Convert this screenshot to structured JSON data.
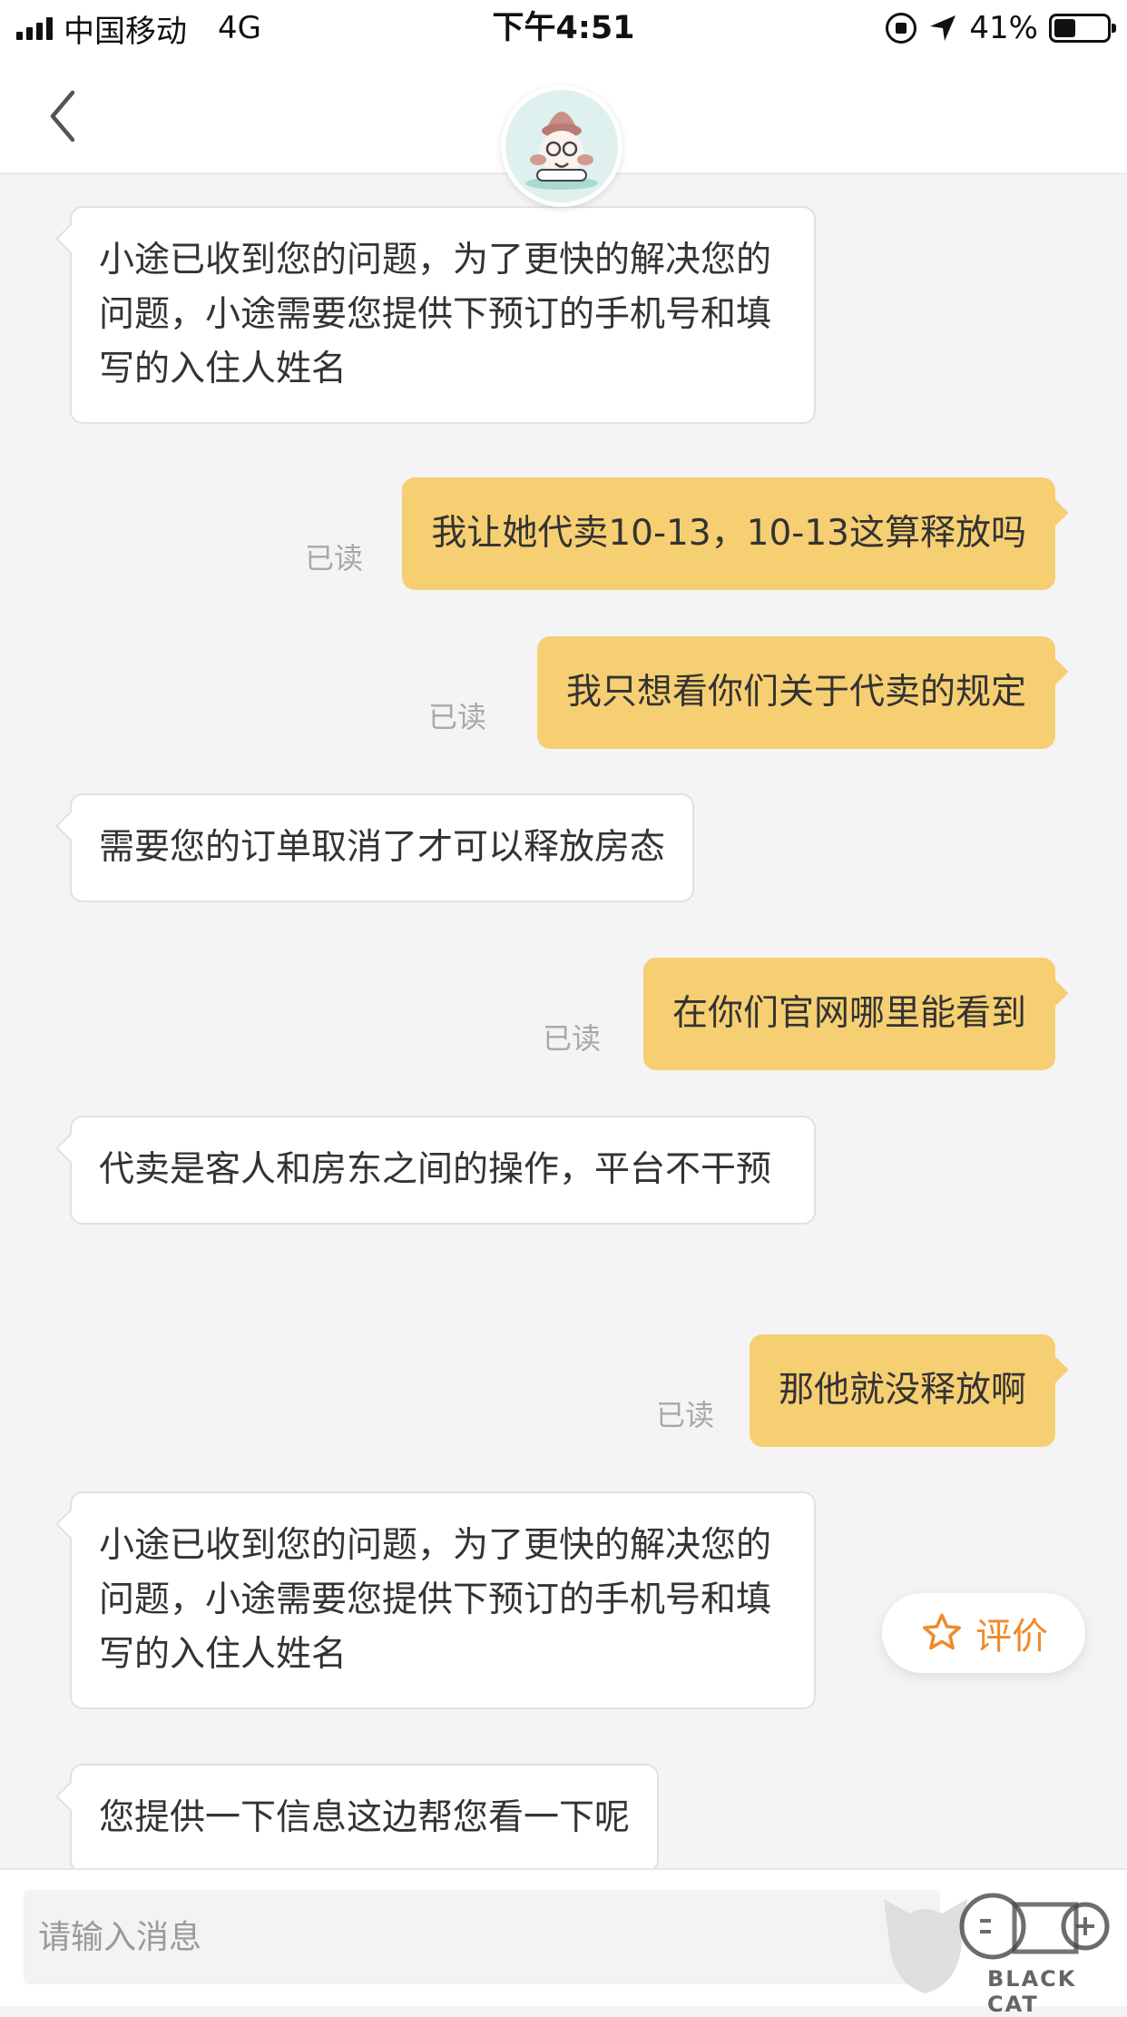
{
  "status_bar": {
    "carrier": "中国移动",
    "network": "4G",
    "time": "下午4:51",
    "battery_text": "41%",
    "battery_level": 0.41
  },
  "chat": {
    "messages": [
      {
        "side": "in",
        "text": "小途已收到您的问题，为了更快的解决您的问题，小途需要您提供下预订的手机号和填写的入住人姓名"
      },
      {
        "side": "out",
        "text": "我让她代卖10-13，10-13这算释放吗",
        "read": "已读"
      },
      {
        "side": "out",
        "text": "我只想看你们关于代卖的规定",
        "read": "已读"
      },
      {
        "side": "in",
        "text": "需要您的订单取消了才可以释放房态"
      },
      {
        "side": "out",
        "text": "在你们官网哪里能看到",
        "read": "已读"
      },
      {
        "side": "in",
        "text": "代卖是客人和房东之间的操作，平台不干预"
      },
      {
        "side": "out",
        "text": "那他就没释放啊",
        "read": "已读"
      },
      {
        "side": "in",
        "text": "小途已收到您的问题，为了更快的解决您的问题，小途需要您提供下预订的手机号和填写的入住人姓名"
      },
      {
        "side": "in",
        "text": "您提供一下信息这边帮您看一下呢"
      }
    ]
  },
  "rate_button": {
    "label": "评价",
    "icon": "star-outline-icon",
    "color": "#f08a2b"
  },
  "input": {
    "placeholder": "请输入消息"
  },
  "watermark": {
    "text": "BLACK CAT",
    "logo": "black-cat-logo"
  },
  "colors": {
    "outgoing_bubble": "#f6cf72",
    "incoming_bubble": "#ffffff",
    "background": "#f4f4f6"
  }
}
